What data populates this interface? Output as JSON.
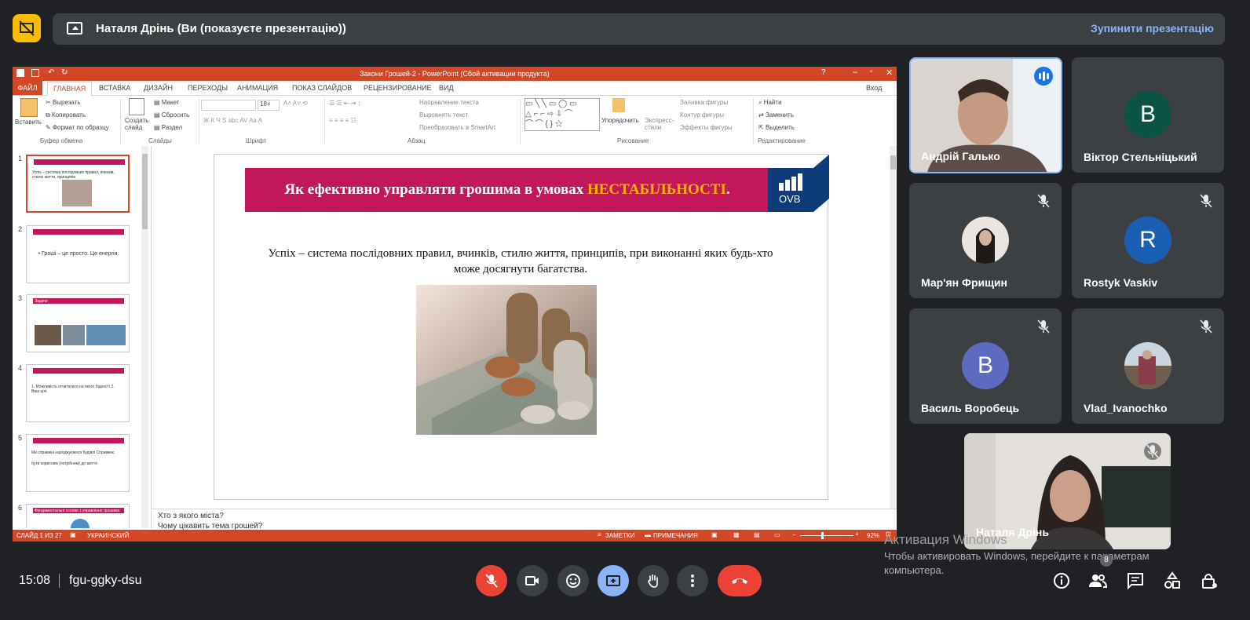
{
  "top_bar": {
    "presenting_text": "Наталя Дрінь (Ви (показуєте презентацію))",
    "stop_button": "Зупинити презентацію"
  },
  "ppt": {
    "window_title": "Закони Грошей-2 -  PowerPoint (Сбой активации продукта)",
    "sign_in": "Вход",
    "tabs": [
      "ФАЙЛ",
      "ГЛАВНАЯ",
      "ВСТАВКА",
      "ДИЗАЙН",
      "ПЕРЕХОДЫ",
      "АНИМАЦИЯ",
      "ПОКАЗ СЛАЙДОВ",
      "РЕЦЕНЗИРОВАНИЕ",
      "ВИД"
    ],
    "ribbon": {
      "paste": "Вставить",
      "cut": "Вырезать",
      "copy": "Копировать",
      "format_painter": "Формат по образцу",
      "clipboard_group": "Буфер обмена",
      "new_slide": "Создать слайд",
      "layout": "Макет",
      "reset": "Сбросить",
      "section": "Раздел",
      "slides_group": "Слайды",
      "font_group": "Шрифт",
      "font_size": "18+",
      "text_direction": "Направление текста",
      "align_text": "Выровнять текст",
      "smartart": "Преобразовать в SmartArt",
      "paragraph_group": "Абзац",
      "arrange": "Упорядочить",
      "quick_styles": "Экспресс-стили",
      "shape_fill": "Заливка фигуры",
      "shape_outline": "Контур фигуры",
      "shape_effects": "Эффекты фигуры",
      "drawing_group": "Рисование",
      "find": "Найти",
      "replace": "Заменить",
      "select": "Выделить",
      "editing_group": "Редактирование"
    },
    "thumbnails": [
      {
        "num": "1",
        "text": "Успіх – система послідовних правил, вчинків, стилю життя, принципів"
      },
      {
        "num": "2",
        "text": "• Гроші – це просто. Це енергія."
      },
      {
        "num": "3",
        "text": "Задачи"
      },
      {
        "num": "4",
        "text": "1. Можливість отчитатися на якого  бідності   2. Ваш цілі"
      },
      {
        "num": "5",
        "text": "Ми справжні народжуємося будівлі    Справжнє бути корисним (потрібним) до життя"
      },
      {
        "num": "6",
        "text": "Фундаментальні основи з управління грошима"
      }
    ],
    "slide": {
      "title_main": "Як ефективно  управляти грошима в умовах ",
      "title_highlight": "НЕСТАБІЛЬНОСТІ",
      "title_end": ".",
      "logo": "OVB",
      "body": "Успіх – система послідовних правил, вчинків, стилю життя, принципів, при виконанні яких будь-хто може досягнути багатства."
    },
    "notes": [
      "Хто з якого міста?",
      "Чому цікавить тема грошей?"
    ],
    "status": {
      "slide": "СЛАЙД 1 ИЗ 27",
      "lang": "УКРАИНСКИЙ",
      "notes": "ЗАМЕТКИ",
      "comments": "ПРИМЕЧАНИЯ",
      "zoom": "92%"
    }
  },
  "participants": [
    {
      "name": "Андрій Галько",
      "type": "video"
    },
    {
      "name": "Віктор Стельніцький",
      "initial": "В",
      "color": "#0b5344",
      "type": "avatar"
    },
    {
      "name": "Мар'ян Фрищин",
      "type": "photo",
      "muted": true
    },
    {
      "name": "Rostyk Vaskiv",
      "initial": "R",
      "color": "#1a5fb4",
      "type": "avatar",
      "muted": true
    },
    {
      "name": "Василь Воробець",
      "initial": "В",
      "color": "#5c6bc0",
      "type": "avatar",
      "muted": true
    },
    {
      "name": "Vlad_Ivanochko",
      "type": "photo",
      "muted": true
    },
    {
      "name": "Наталя Дрінь",
      "type": "video",
      "muted": true
    }
  ],
  "activation": {
    "title": "Активация Windows",
    "text": "Чтобы активировать Windows, перейдите к параметрам компьютера."
  },
  "bottom_bar": {
    "time": "15:08",
    "meeting_code": "fgu-ggky-dsu",
    "people_count": "8"
  }
}
